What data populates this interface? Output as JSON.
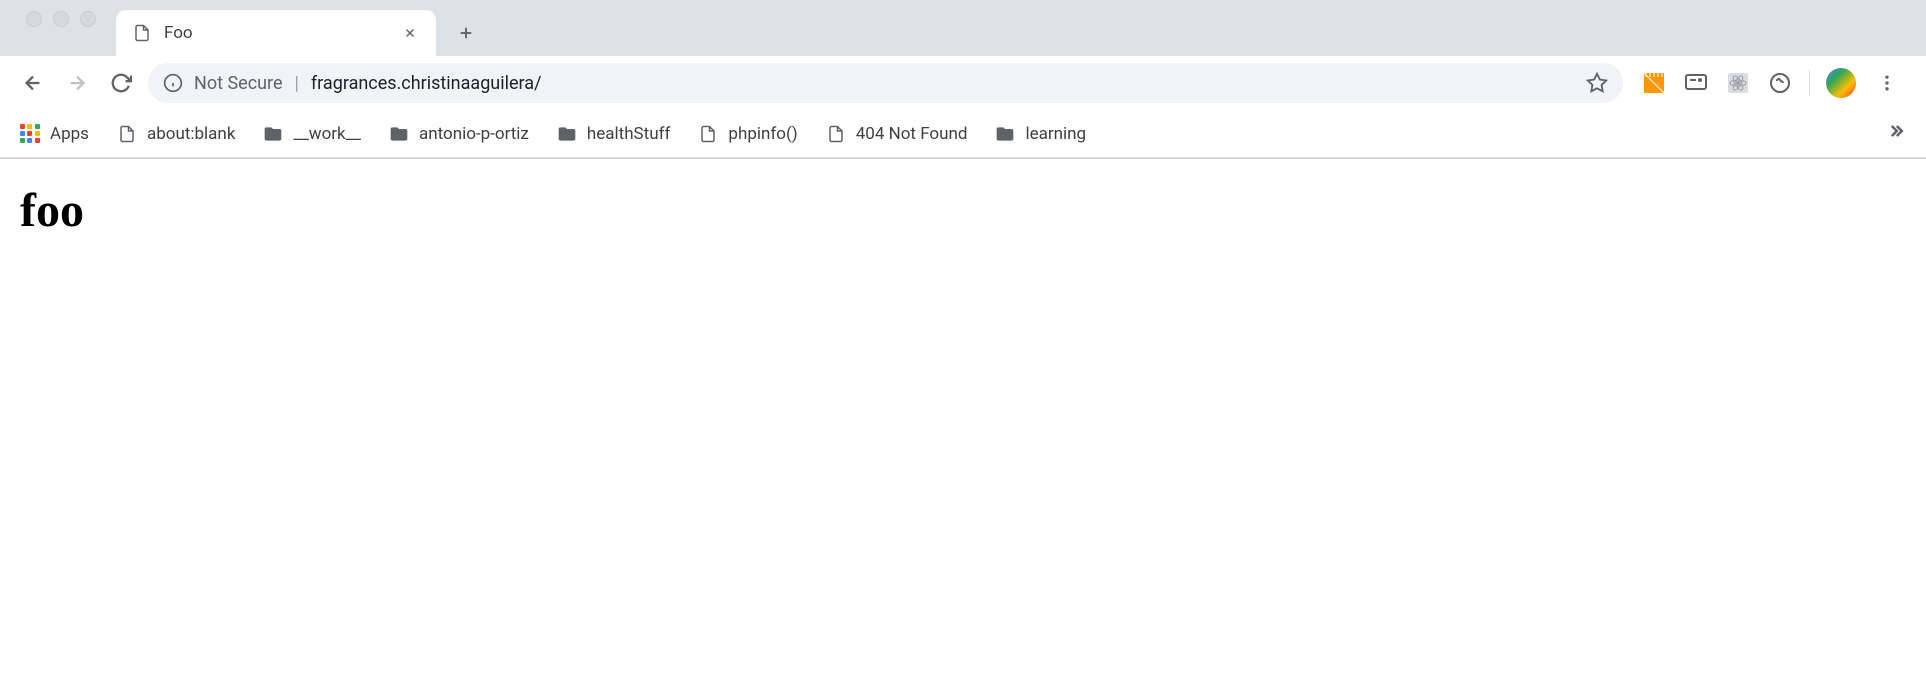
{
  "tab": {
    "title": "Foo"
  },
  "address_bar": {
    "security_text": "Not Secure",
    "url": "fragrances.christinaaguilera/"
  },
  "bookmarks": {
    "apps_label": "Apps",
    "items": [
      {
        "type": "page",
        "label": "about:blank"
      },
      {
        "type": "folder",
        "label": "__work__"
      },
      {
        "type": "folder",
        "label": "antonio-p-ortiz"
      },
      {
        "type": "folder",
        "label": "healthStuff"
      },
      {
        "type": "page",
        "label": "phpinfo()"
      },
      {
        "type": "page",
        "label": "404 Not Found"
      },
      {
        "type": "folder",
        "label": "learning"
      }
    ]
  },
  "page": {
    "heading": "foo"
  }
}
